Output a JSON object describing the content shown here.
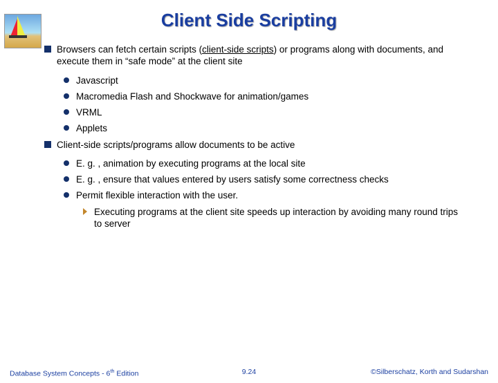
{
  "title": "Client Side Scripting",
  "bullets": {
    "p1_a": "Browsers can fetch certain scripts (",
    "p1_u": "client-side scripts",
    "p1_b": ") or programs along with documents, and execute them in “safe mode” at the client site",
    "s1": "Javascript",
    "s2": "Macromedia Flash and Shockwave for animation/games",
    "s3": "VRML",
    "s4": "Applets",
    "p2": "Client-side scripts/programs allow documents to be active",
    "s5": "E. g. , animation by executing programs at the local site",
    "s6": "E. g. , ensure that values entered by users satisfy some correctness checks",
    "s7": "Permit flexible interaction with the user.",
    "t1": "Executing programs at the client site speeds up interaction by avoiding many round trips to server"
  },
  "footer": {
    "left_a": "Database System Concepts - 6",
    "left_sup": "th",
    "left_b": " Edition",
    "center": "9.24",
    "right": "©Silberschatz, Korth and Sudarshan"
  }
}
